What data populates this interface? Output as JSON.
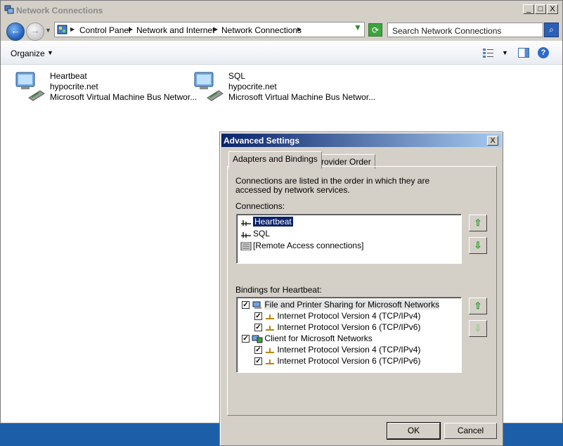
{
  "window": {
    "title": "Network Connections",
    "controls": {
      "minimize": "_",
      "maximize": "□",
      "close": "X"
    }
  },
  "address": {
    "crumbs": [
      "Control Panel",
      "Network and Internet",
      "Network Connections"
    ],
    "search_placeholder": "Search Network Connections"
  },
  "toolbar": {
    "organize_label": "Organize"
  },
  "connections": [
    {
      "name": "Heartbeat",
      "domain": "hypocrite.net",
      "device": "Microsoft Virtual Machine Bus Networ..."
    },
    {
      "name": "SQL",
      "domain": "hypocrite.net",
      "device": "Microsoft Virtual Machine Bus Networ..."
    }
  ],
  "dialog": {
    "title": "Advanced Settings",
    "close": "X",
    "tabs": [
      "Adapters and Bindings",
      "Provider Order"
    ],
    "description": "Connections are listed in the order in which they are accessed by network services.",
    "connections_label": "Connections:",
    "connections": [
      "Heartbeat",
      "SQL",
      "[Remote Access connections]"
    ],
    "selected_connection": "Heartbeat",
    "bindings_label": "Bindings for Heartbeat:",
    "bindings": [
      {
        "label": "File and Printer Sharing for Microsoft Networks",
        "checked": true,
        "level": 0
      },
      {
        "label": "Internet Protocol Version 4 (TCP/IPv4)",
        "checked": true,
        "level": 1
      },
      {
        "label": "Internet Protocol Version 6 (TCP/IPv6)",
        "checked": true,
        "level": 1
      },
      {
        "label": "Client for Microsoft Networks",
        "checked": true,
        "level": 0
      },
      {
        "label": "Internet Protocol Version 4 (TCP/IPv4)",
        "checked": true,
        "level": 1
      },
      {
        "label": "Internet Protocol Version 6 (TCP/IPv6)",
        "checked": true,
        "level": 1
      }
    ],
    "ok_label": "OK",
    "cancel_label": "Cancel"
  }
}
